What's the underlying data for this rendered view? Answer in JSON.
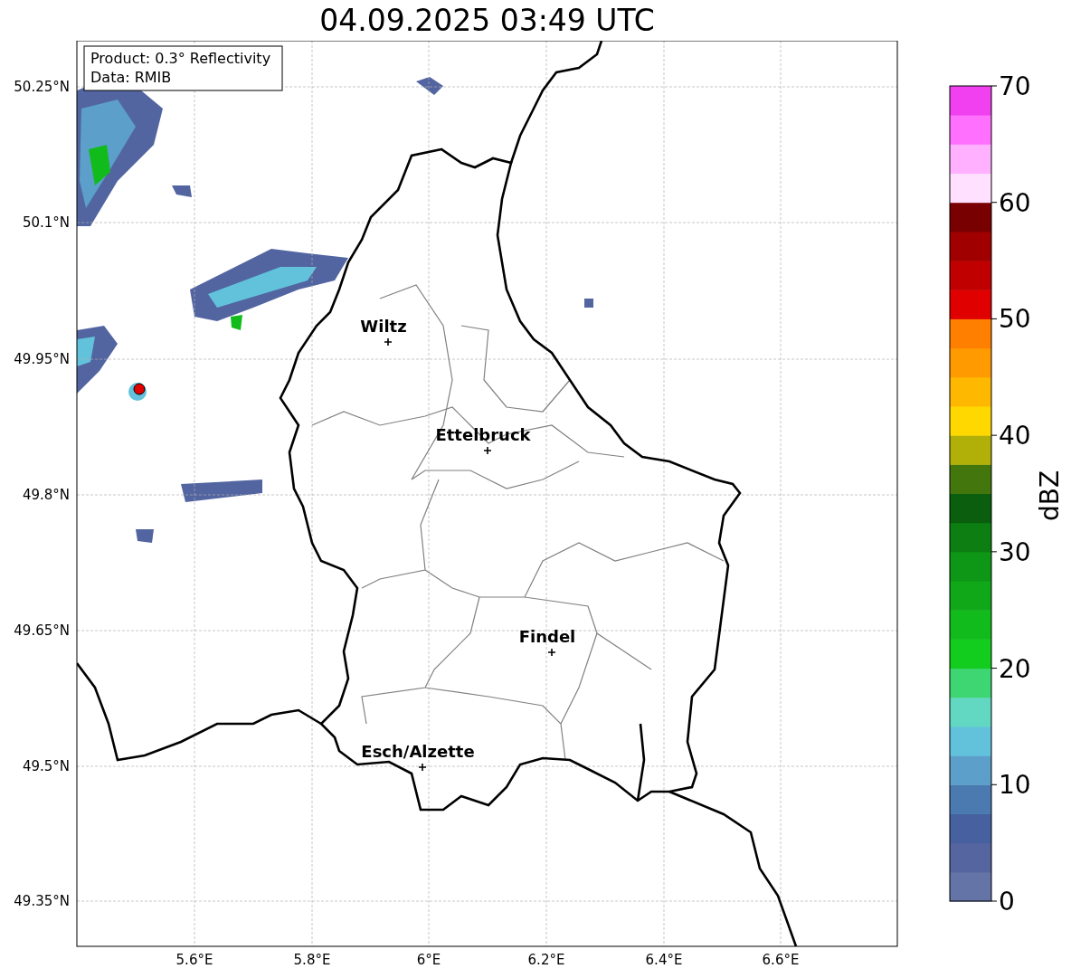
{
  "title": "04.09.2025 03:49 UTC",
  "annotation": [
    "Product: 0.3° Reflectivity",
    "Data: RMIB"
  ],
  "cities": [
    {
      "name": "Wiltz"
    },
    {
      "name": "Ettelbruck"
    },
    {
      "name": "Findel"
    },
    {
      "name": "Esch/Alzette"
    }
  ],
  "y_ticks": [
    "50.25°N",
    "50.1°N",
    "49.95°N",
    "49.8°N",
    "49.65°N",
    "49.5°N",
    "49.35°N"
  ],
  "x_ticks": [
    "5.6°E",
    "5.8°E",
    "6°E",
    "6.2°E",
    "6.4°E",
    "6.6°E"
  ],
  "colorbar": {
    "label": "dBZ",
    "ticks": [
      "70",
      "60",
      "50",
      "40",
      "30",
      "20",
      "10",
      "0"
    ],
    "bins": [
      {
        "color": "#6474a6"
      },
      {
        "color": "#5565a0"
      },
      {
        "color": "#4660a0"
      },
      {
        "color": "#4a7ab0"
      },
      {
        "color": "#5b9fca"
      },
      {
        "color": "#62c2dc"
      },
      {
        "color": "#62d8c2"
      },
      {
        "color": "#3ed672"
      },
      {
        "color": "#12cc1e"
      },
      {
        "color": "#12bb1c"
      },
      {
        "color": "#10a818"
      },
      {
        "color": "#0e9616"
      },
      {
        "color": "#0c7e12"
      },
      {
        "color": "#0a5e0e"
      },
      {
        "color": "#44760e"
      },
      {
        "color": "#b0b008"
      },
      {
        "color": "#ffd800"
      },
      {
        "color": "#ffb800"
      },
      {
        "color": "#ff9a00"
      },
      {
        "color": "#ff7f00"
      },
      {
        "color": "#e00000"
      },
      {
        "color": "#c00000"
      },
      {
        "color": "#a00000"
      },
      {
        "color": "#780000"
      },
      {
        "color": "#ffe0ff"
      },
      {
        "color": "#ffb0ff"
      },
      {
        "color": "#ff70ff"
      },
      {
        "color": "#f040f0"
      }
    ]
  }
}
